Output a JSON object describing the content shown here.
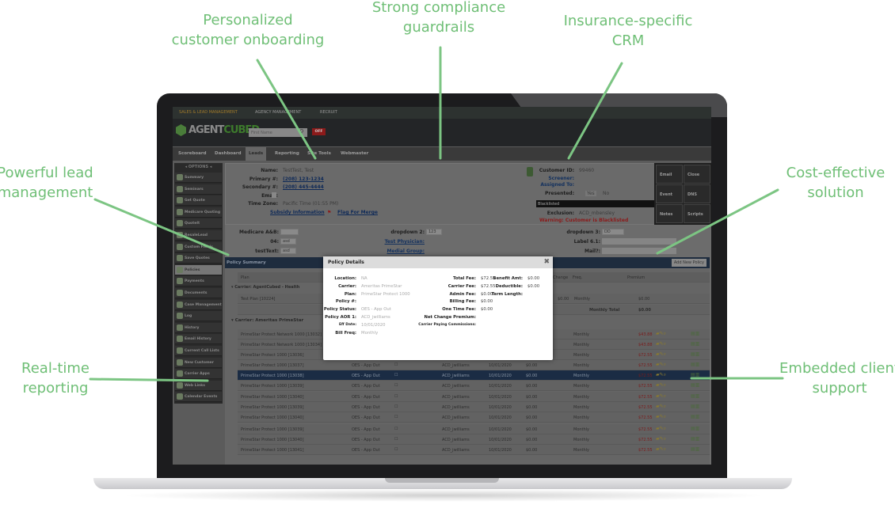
{
  "callouts": {
    "onboarding": [
      "Personalized",
      "customer onboarding"
    ],
    "compliance": [
      "Strong compliance",
      "guardrails"
    ],
    "crm": [
      "Insurance-specific",
      "CRM"
    ],
    "lead": [
      "Powerful lead",
      "management"
    ],
    "cost": [
      "Cost-effective",
      "solution"
    ],
    "reporting": [
      "Real-time",
      "reporting"
    ],
    "support": [
      "Embedded client",
      "support"
    ]
  },
  "colors": {
    "callout": "#6fbf76",
    "accent_red": "#c0262b"
  },
  "app": {
    "top_tabs": [
      "SALES & LEAD MANAGEMENT",
      "AGENCY MANAGEMENT",
      "RECRUIT"
    ],
    "logo": {
      "a": "AGENT",
      "b": "CUBED"
    },
    "search_placeholder": "First Name",
    "off_label": "OFF",
    "nav": [
      "Scoreboard",
      "Dashboard",
      "Leads",
      "Reporting",
      "Site Tools",
      "Webmaster"
    ],
    "sidebar": {
      "header": "OPTIONS",
      "items": [
        "Summary",
        "Seminars",
        "Get Quote",
        "Medicare Quoting",
        "QuoteIt",
        "ResaleLead",
        "Custom Fields",
        "Save Quotes",
        "Policies",
        "Payments",
        "Documents",
        "Case Management",
        "Log",
        "History",
        "Email History",
        "Current Call Lists",
        "New Customer",
        "Carrier Apps",
        "Web Links",
        "Calendar Events"
      ]
    },
    "lead": {
      "name_label": "Name:",
      "name": "TestTest, Test",
      "primary_label": "Primary #:",
      "primary": "(208) 123-1234",
      "secondary_label": "Secondary #:",
      "secondary": "(208) 445-4444",
      "email_label": "Email:",
      "tz_label": "Time Zone:",
      "tz": "Pacific Time (01:55 PM)",
      "subsidy": "Subsidy Information",
      "flag": "Flag For Merge",
      "cust_id_label": "Customer ID:",
      "cust_id": "99460",
      "screener": "Screener:",
      "assigned": "Assigned To:",
      "presented_label": "Presented:",
      "yes": "Yes",
      "no": "No",
      "blacklist": "Blacklisted",
      "exclusion_label": "Exclusion:",
      "exclusion": "ACD_mbensley",
      "warning": "Warning: Customer is Blacklisted"
    },
    "actions": [
      "Email",
      "Close",
      "Event",
      "DNS",
      "Notes",
      "Scripts"
    ],
    "fields": {
      "medicare": "Medicare A&B:",
      "f04": "04:",
      "f04v": "asd",
      "testtext": "testText:",
      "testtextv": "asd",
      "dd2": "dropdown 2:",
      "dd2v": "123",
      "physician": "Test Physician:",
      "medial": "Medial Group:",
      "dd3": "dropdown 3:",
      "dd3v": "DD",
      "label61": "Label 6.1:",
      "mail": "Mail?:"
    },
    "policy_summary": "Policy Summary",
    "add_policy": "Add New Policy",
    "table": {
      "headers": [
        "Plan",
        "Change",
        "Freq.",
        "Premium"
      ],
      "group1": "Carrier: AgentCubed - Health",
      "test_plan": {
        "plan": "Test Plan [10224]",
        "fee": "$0.00",
        "freq": "Monthly",
        "premium": "$0.00"
      },
      "total_label": "Monthly Total",
      "total": "$0.00",
      "group2": "Carrier: Ameritas PrimeStar",
      "rows": [
        {
          "plan": "PrimeStar Protect Network 1000 [13032]",
          "status": "",
          "aor": "",
          "date": "",
          "fee": "",
          "freq": "Monthly",
          "premium": "$43.88"
        },
        {
          "plan": "PrimeStar Protect Network 1000 [13034]",
          "status": "",
          "aor": "",
          "date": "",
          "fee": "",
          "freq": "Monthly",
          "premium": "$43.88"
        },
        {
          "plan": "PrimeStar Protect 1000 [13036]",
          "status": "",
          "aor": "",
          "date": "",
          "fee": "",
          "freq": "Monthly",
          "premium": "$72.55"
        },
        {
          "plan": "PrimeStar Protect 1000 [13037]",
          "status": "OES - App Out",
          "aor": "ACD_jwilliams",
          "date": "10/01/2020",
          "fee": "$0.00",
          "freq": "Monthly",
          "premium": "$72.55"
        },
        {
          "plan": "PrimeStar Protect 1000 [13038]",
          "status": "OES - App Out",
          "aor": "ACD_jwilliams",
          "date": "10/01/2020",
          "fee": "$0.00",
          "freq": "Monthly",
          "premium": "$72.55",
          "selected": true
        },
        {
          "plan": "PrimeStar Protect 1000 [13039]",
          "status": "OES - App Out",
          "aor": "ACD_jwilliams",
          "date": "10/01/2020",
          "fee": "$0.00",
          "freq": "Monthly",
          "premium": "$72.55"
        },
        {
          "plan": "PrimeStar Protect 1000 [13040]",
          "status": "OES - App Out",
          "aor": "ACD_jwilliams",
          "date": "10/01/2020",
          "fee": "$0.00",
          "freq": "Monthly",
          "premium": "$72.55"
        },
        {
          "plan": "PrimeStar Protect 1000 [13039]",
          "status": "OES - App Out",
          "aor": "ACD_jwilliams",
          "date": "10/01/2020",
          "fee": "$0.00",
          "freq": "Monthly",
          "premium": "$72.55"
        },
        {
          "plan": "PrimeStar Protect 1000 [13040]",
          "status": "OES - App Out",
          "aor": "ACD_jwilliams",
          "date": "10/01/2020",
          "fee": "$0.00",
          "freq": "Monthly",
          "premium": "$72.55"
        },
        {
          "plan": "PrimeStar Protect 1000 [13039]",
          "status": "OES - App Out",
          "aor": "ACD_jwilliams",
          "date": "10/01/2020",
          "fee": "$0.00",
          "freq": "Monthly",
          "premium": "$72.55"
        },
        {
          "plan": "PrimeStar Protect 1000 [13040]",
          "status": "OES - App Out",
          "aor": "ACD_jwilliams",
          "date": "10/01/2020",
          "fee": "$0.00",
          "freq": "Monthly",
          "premium": "$72.55"
        },
        {
          "plan": "PrimeStar Protect 1000 [13041]",
          "status": "OES - App Out",
          "aor": "ACD_jwilliams",
          "date": "10/01/2020",
          "fee": "$0.00",
          "freq": "Monthly",
          "premium": "$72.55"
        }
      ]
    },
    "modal": {
      "title": "Policy Details",
      "left": [
        [
          "Location:",
          "NA"
        ],
        [
          "Carrier:",
          "Ameritas PrimeStar"
        ],
        [
          "Plan:",
          "PrimeStar Protect 1000"
        ],
        [
          "Policy #:",
          ""
        ],
        [
          "Policy Status:",
          "OES - App Out"
        ],
        [
          "Policy AOR 1:",
          "ACD_jwilliams"
        ],
        [
          "Eff Date:",
          "10/01/2020"
        ],
        [
          "Bill Freq:",
          "Monthly"
        ]
      ],
      "mid": [
        [
          "Total Fee:",
          "$72.55"
        ],
        [
          "Carrier Fee:",
          "$72.55"
        ],
        [
          "Admin Fee:",
          "$0.00"
        ],
        [
          "Billing Fee:",
          "$0.00"
        ],
        [
          "One Time Fee:",
          "$0.00"
        ],
        [
          "Net Change Premium:",
          ""
        ],
        [
          "Carrier Paying Commissions:",
          ""
        ]
      ],
      "right": [
        [
          "Benefit Amt:",
          "$0.00"
        ],
        [
          "Deductible:",
          "$0.00"
        ],
        [
          "Term Length:",
          ""
        ]
      ]
    }
  }
}
